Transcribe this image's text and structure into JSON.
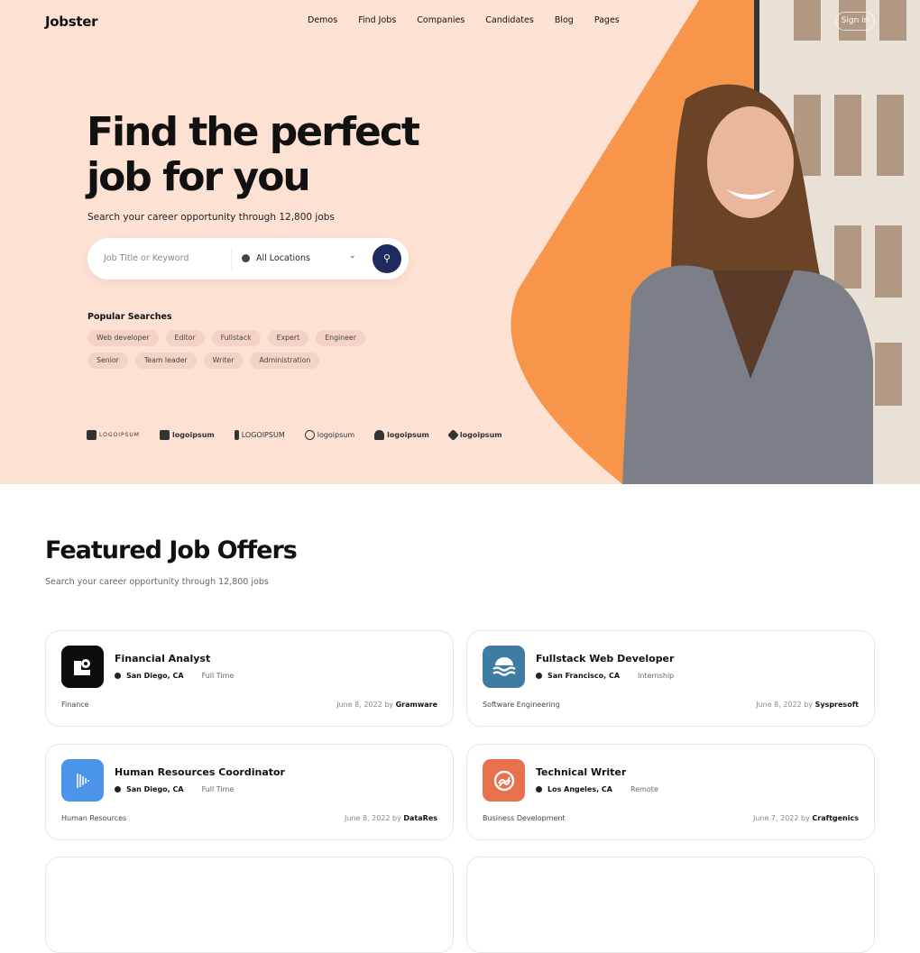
{
  "header": {
    "logo": "Jobster",
    "nav": [
      "Demos",
      "Find Jobs",
      "Companies",
      "Candidates",
      "Blog",
      "Pages"
    ],
    "sign_in": "Sign in"
  },
  "hero": {
    "title": "Find the perfect job for you",
    "subtitle": "Search your career opportunity through 12,800 jobs",
    "search": {
      "keyword_placeholder": "Job Title or Keyword",
      "location": "All Locations"
    },
    "popular_label": "Popular Searches",
    "tags": [
      "Web developer",
      "Editor",
      "Fullstack",
      "Expert",
      "Engineer",
      "Senior",
      "Team leader",
      "Writer",
      "Administration"
    ],
    "brands": [
      "LOGOIPSUM",
      "logoipsum",
      "LOGOIPSUM",
      "logoipsum",
      "logoipsum",
      "logoipsum"
    ],
    "colors": {
      "background": "#fde2d4",
      "accent": "#f7954a",
      "search_button": "#1e2a5e"
    }
  },
  "featured": {
    "title": "Featured Job Offers",
    "subtitle": "Search your career opportunity through 12,800 jobs",
    "jobs": [
      {
        "title": "Financial Analyst",
        "location": "San Diego, CA",
        "type": "Full Time",
        "category": "Finance",
        "date": "June 8, 2022 by",
        "company": "Gramware",
        "icon_color": "#0d0d0d"
      },
      {
        "title": "Fullstack Web Developer",
        "location": "San Francisco, CA",
        "type": "Internship",
        "category": "Software Engineering",
        "date": "June 8, 2022 by",
        "company": "Syspresoft",
        "icon_color": "#3f7ca4"
      },
      {
        "title": "Human Resources Coordinator",
        "location": "San Diego, CA",
        "type": "Full Time",
        "category": "Human Resources",
        "date": "June 8, 2022 by",
        "company": "DataRes",
        "icon_color": "#4a94ea"
      },
      {
        "title": "Technical Writer",
        "location": "Los Angeles, CA",
        "type": "Remote",
        "category": "Business Development",
        "date": "June 7, 2022 by",
        "company": "Craftgenics",
        "icon_color": "#e8704c"
      }
    ]
  }
}
